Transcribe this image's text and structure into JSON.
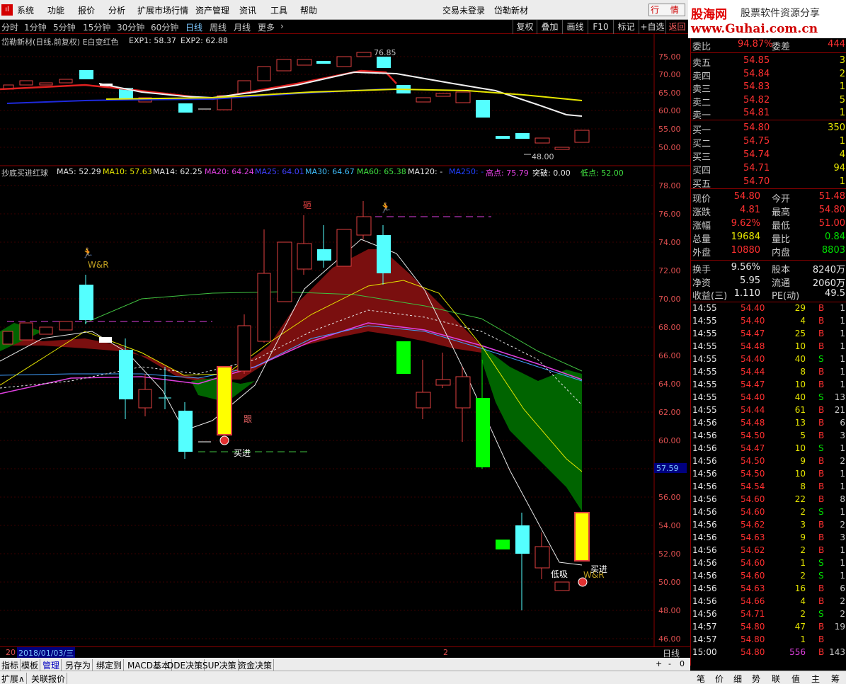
{
  "menu": {
    "items": [
      "系统",
      "功能",
      "报价",
      "分析",
      "扩展市场行情",
      "资产管理",
      "资讯",
      "工具",
      "帮助"
    ],
    "login_status": "交易未登录",
    "stock_name": "岱勒新材",
    "trade_button": "行 情"
  },
  "banner": {
    "title": "股海网",
    "subtitle": "股票软件资源分享",
    "url": "www.Guhai.com.cn"
  },
  "periods": {
    "items": [
      "分时",
      "1分钟",
      "5分钟",
      "15分钟",
      "30分钟",
      "60分钟",
      "日线",
      "周线",
      "月线",
      "更多"
    ],
    "active": "日线"
  },
  "toolbar": {
    "items": [
      "复权",
      "叠加",
      "画线",
      "F10",
      "标记",
      "+自选",
      "返回"
    ]
  },
  "top_chart": {
    "legend_title": "岱勒新材(日线,前复权) E白变红色",
    "exp1": "EXP1: 58.37",
    "exp2": "EXP2: 62.88",
    "y_ticks": [
      "75.00",
      "70.00",
      "65.00",
      "60.00",
      "55.00",
      "50.00"
    ],
    "high_label": "76.85",
    "low_label": "48.00",
    "colors": {
      "exp1_line": "#e02020",
      "exp2_line": "#1e2adc",
      "white_line": "#f0f0f0",
      "yellow_line": "#e6e600"
    }
  },
  "main_chart": {
    "legend_title": "抄底买进红球",
    "ma5": "MA5: 52.29",
    "ma10": "MA10: 57.63",
    "ma14": "MA14: 62.25",
    "ma20": "MA20: 64.24",
    "ma25": "MA25: 64.01",
    "ma30": "MA30: 64.67",
    "ma60": "MA60: 65.38",
    "ma120": "MA120: -",
    "ma250": "MA250: -",
    "high": "高点: 75.79",
    "breakout": "突破: 0.00",
    "low": "低点: 52.00",
    "y_ticks": [
      "78.00",
      "76.00",
      "74.00",
      "72.00",
      "70.00",
      "68.00",
      "66.00",
      "64.00",
      "62.00",
      "60.00",
      "58.00",
      "56.00",
      "54.00",
      "52.00",
      "50.00",
      "48.00",
      "46.00"
    ],
    "current_price_tag": "57.59",
    "annotations": {
      "wr1": "W&R",
      "wr2": "W&R",
      "za": "砸",
      "gen": "跟",
      "buy1": "买进",
      "buy2": "买进",
      "low_buy": "低吸"
    }
  },
  "status": {
    "date_prefix": "20",
    "date": "2018/01/03/三",
    "marker": "2",
    "period_label": "日线",
    "zoom": [
      "+",
      "-",
      "0"
    ]
  },
  "bottom_tabs": [
    "指标",
    "模板",
    "管理",
    "另存为",
    "绑定到",
    "MACD基本",
    "DDE决策",
    "SUP决策",
    "资金决策"
  ],
  "bottom_bar": [
    "扩展∧",
    "关联报价"
  ],
  "right_tabs": [
    "笔",
    "价",
    "细",
    "势",
    "联",
    "值",
    "主",
    "筹"
  ],
  "quote": {
    "weibi": {
      "label": "委比",
      "value": "94.87%",
      "label2": "委差",
      "value2": "444"
    },
    "asks": [
      {
        "label": "卖五",
        "price": "54.85",
        "vol": "3"
      },
      {
        "label": "卖四",
        "price": "54.84",
        "vol": "2"
      },
      {
        "label": "卖三",
        "price": "54.83",
        "vol": "1"
      },
      {
        "label": "卖二",
        "price": "54.82",
        "vol": "5"
      },
      {
        "label": "卖一",
        "price": "54.81",
        "vol": "1"
      }
    ],
    "bids": [
      {
        "label": "买一",
        "price": "54.80",
        "vol": "350"
      },
      {
        "label": "买二",
        "price": "54.75",
        "vol": "1"
      },
      {
        "label": "买三",
        "price": "54.74",
        "vol": "4"
      },
      {
        "label": "买四",
        "price": "54.71",
        "vol": "94"
      },
      {
        "label": "买五",
        "price": "54.70",
        "vol": "1"
      }
    ],
    "stats": [
      {
        "l1": "现价",
        "v1": "54.80",
        "l2": "今开",
        "v2": "51.48",
        "c1": "#ff3030",
        "c2": "#ff3030"
      },
      {
        "l1": "涨跌",
        "v1": "4.81",
        "l2": "最高",
        "v2": "54.80",
        "c1": "#ff3030",
        "c2": "#ff3030"
      },
      {
        "l1": "涨幅",
        "v1": "9.62%",
        "l2": "最低",
        "v2": "51.00",
        "c1": "#ff3030",
        "c2": "#ff3030"
      },
      {
        "l1": "总量",
        "v1": "19684",
        "l2": "量比",
        "v2": "0.84",
        "c1": "#e6e600",
        "c2": "#00e000"
      },
      {
        "l1": "外盘",
        "v1": "10880",
        "l2": "内盘",
        "v2": "8803",
        "c1": "#ff3030",
        "c2": "#00e000"
      }
    ],
    "stats2": [
      {
        "l1": "换手",
        "v1": "9.56%",
        "l2": "股本",
        "v2": "8240万"
      },
      {
        "l1": "净资",
        "v1": "5.95",
        "l2": "流通",
        "v2": "2060万"
      },
      {
        "l1": "收益(三)",
        "v1": "1.110",
        "l2": "PE(动)",
        "v2": "49.5"
      }
    ]
  },
  "ticks": [
    {
      "t": "14:55",
      "p": "54.40",
      "v": "29",
      "bs": "B",
      "n": "1"
    },
    {
      "t": "14:55",
      "p": "54.40",
      "v": "4",
      "bs": "B",
      "n": "1"
    },
    {
      "t": "14:55",
      "p": "54.47",
      "v": "25",
      "bs": "B",
      "n": "1"
    },
    {
      "t": "14:55",
      "p": "54.48",
      "v": "10",
      "bs": "B",
      "n": "1"
    },
    {
      "t": "14:55",
      "p": "54.40",
      "v": "40",
      "bs": "S",
      "n": "1"
    },
    {
      "t": "14:55",
      "p": "54.44",
      "v": "8",
      "bs": "B",
      "n": "1"
    },
    {
      "t": "14:55",
      "p": "54.47",
      "v": "10",
      "bs": "B",
      "n": "1"
    },
    {
      "t": "14:55",
      "p": "54.40",
      "v": "40",
      "bs": "S",
      "n": "13"
    },
    {
      "t": "14:55",
      "p": "54.44",
      "v": "61",
      "bs": "B",
      "n": "21"
    },
    {
      "t": "14:56",
      "p": "54.48",
      "v": "13",
      "bs": "B",
      "n": "6"
    },
    {
      "t": "14:56",
      "p": "54.50",
      "v": "5",
      "bs": "B",
      "n": "3"
    },
    {
      "t": "14:56",
      "p": "54.47",
      "v": "10",
      "bs": "S",
      "n": "1"
    },
    {
      "t": "14:56",
      "p": "54.50",
      "v": "9",
      "bs": "B",
      "n": "2"
    },
    {
      "t": "14:56",
      "p": "54.50",
      "v": "10",
      "bs": "B",
      "n": "1"
    },
    {
      "t": "14:56",
      "p": "54.54",
      "v": "8",
      "bs": "B",
      "n": "1"
    },
    {
      "t": "14:56",
      "p": "54.60",
      "v": "22",
      "bs": "B",
      "n": "8"
    },
    {
      "t": "14:56",
      "p": "54.60",
      "v": "2",
      "bs": "S",
      "n": "1"
    },
    {
      "t": "14:56",
      "p": "54.62",
      "v": "3",
      "bs": "B",
      "n": "2"
    },
    {
      "t": "14:56",
      "p": "54.63",
      "v": "9",
      "bs": "B",
      "n": "3"
    },
    {
      "t": "14:56",
      "p": "54.62",
      "v": "2",
      "bs": "B",
      "n": "1"
    },
    {
      "t": "14:56",
      "p": "54.60",
      "v": "1",
      "bs": "S",
      "n": "1"
    },
    {
      "t": "14:56",
      "p": "54.60",
      "v": "2",
      "bs": "S",
      "n": "1"
    },
    {
      "t": "14:56",
      "p": "54.63",
      "v": "16",
      "bs": "B",
      "n": "6"
    },
    {
      "t": "14:56",
      "p": "54.66",
      "v": "4",
      "bs": "B",
      "n": "2"
    },
    {
      "t": "14:56",
      "p": "54.71",
      "v": "2",
      "bs": "S",
      "n": "2"
    },
    {
      "t": "14:57",
      "p": "54.80",
      "v": "47",
      "bs": "B",
      "n": "19"
    },
    {
      "t": "14:57",
      "p": "54.80",
      "v": "1",
      "bs": "B",
      "n": ""
    },
    {
      "t": "15:00",
      "p": "54.80",
      "v": "556",
      "bs": "B",
      "n": "143"
    }
  ]
}
